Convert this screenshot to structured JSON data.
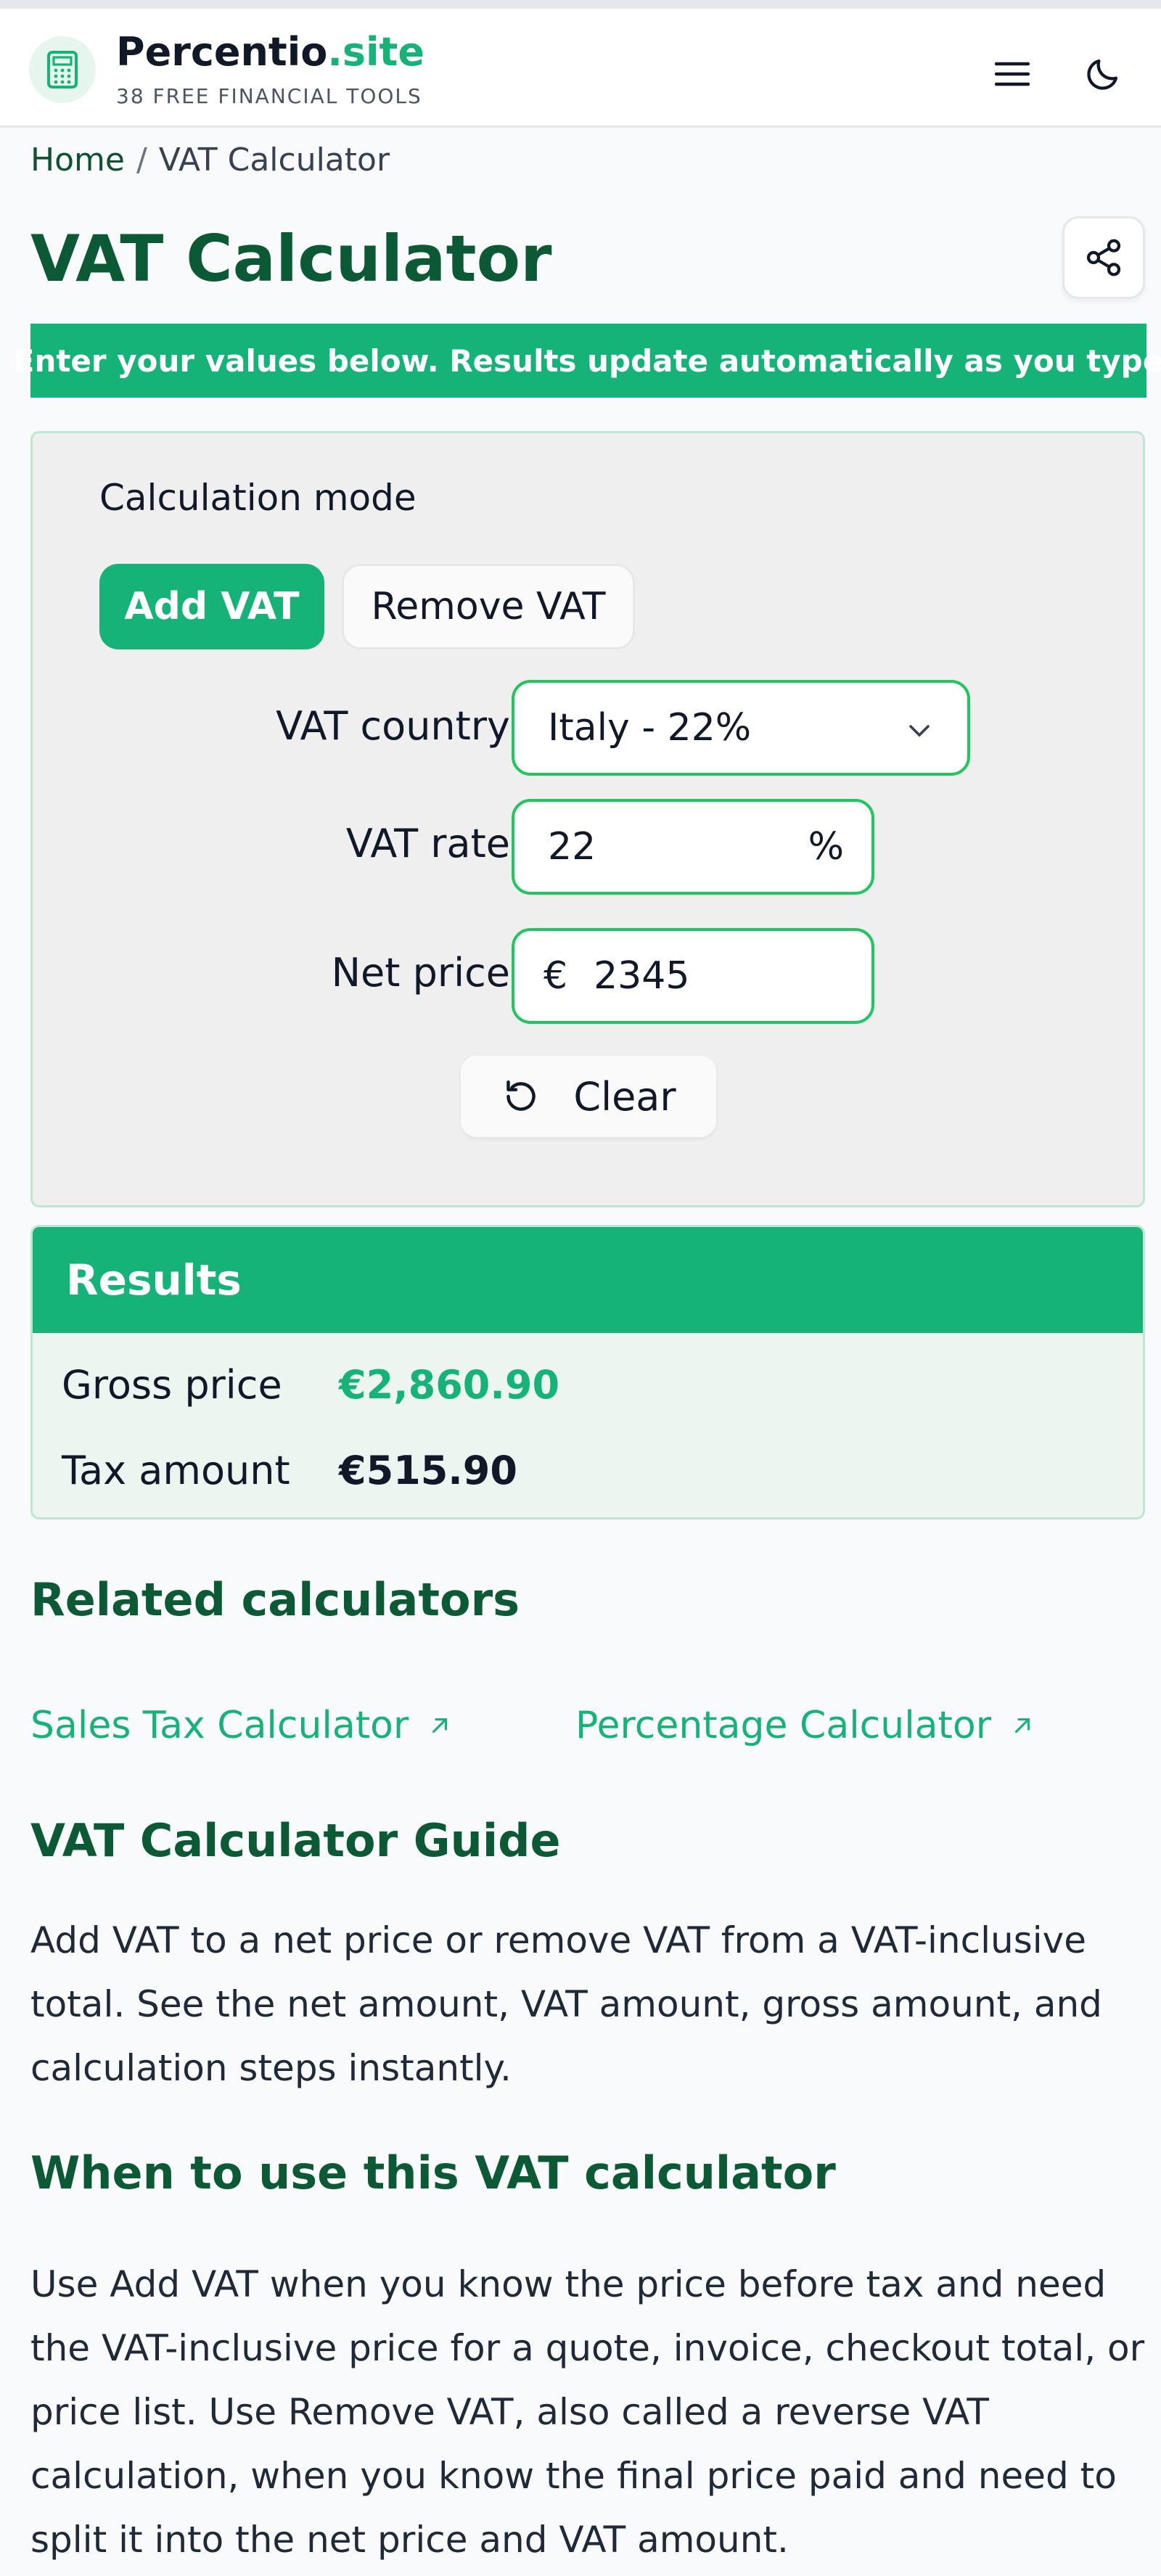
{
  "header": {
    "brand_main": "Percentio",
    "brand_accent": ".site",
    "tagline": "38 FREE FINANCIAL TOOLS",
    "logo_icon": "calculator-icon",
    "menu_icon": "hamburger-menu-icon",
    "theme_icon": "moon-icon"
  },
  "breadcrumb": {
    "home": "Home",
    "separator": "/",
    "current": "VAT Calculator"
  },
  "page": {
    "title": "VAT Calculator",
    "share_icon": "share-icon"
  },
  "banner": {
    "text": "Enter your values below. Results update automatically as you type"
  },
  "calculator": {
    "mode_label": "Calculation mode",
    "modes": [
      "Add VAT",
      "Remove VAT"
    ],
    "selected_mode": "Add VAT",
    "country_label": "VAT country",
    "country_value": "Italy - 22%",
    "rate_label": "VAT rate",
    "rate_value": "22",
    "rate_unit": "%",
    "net_label": "Net price",
    "currency": "€",
    "net_value": "2345",
    "clear_label": "Clear"
  },
  "results": {
    "title": "Results",
    "gross_label": "Gross price",
    "gross_value": "€2,860.90",
    "tax_label": "Tax amount",
    "tax_value": "€515.90"
  },
  "related": {
    "title": "Related calculators",
    "links": [
      "Sales Tax Calculator",
      "Percentage Calculator"
    ]
  },
  "guide": {
    "title": "VAT Calculator Guide",
    "text": "Add VAT to a net price or remove VAT from a VAT-inclusive total. See the net amount, VAT amount, gross amount, and calculation steps instantly."
  },
  "when": {
    "title": "When to use this VAT calculator",
    "text": "Use Add VAT when you know the price before tax and need the VAT-inclusive price for a quote, invoice, checkout total, or price list. Use Remove VAT, also called a reverse VAT calculation, when you know the final price paid and need to split it into the net price and VAT amount."
  },
  "colors": {
    "accent": "#15b378",
    "heading": "#0b5a35",
    "border": "#22c55e"
  }
}
